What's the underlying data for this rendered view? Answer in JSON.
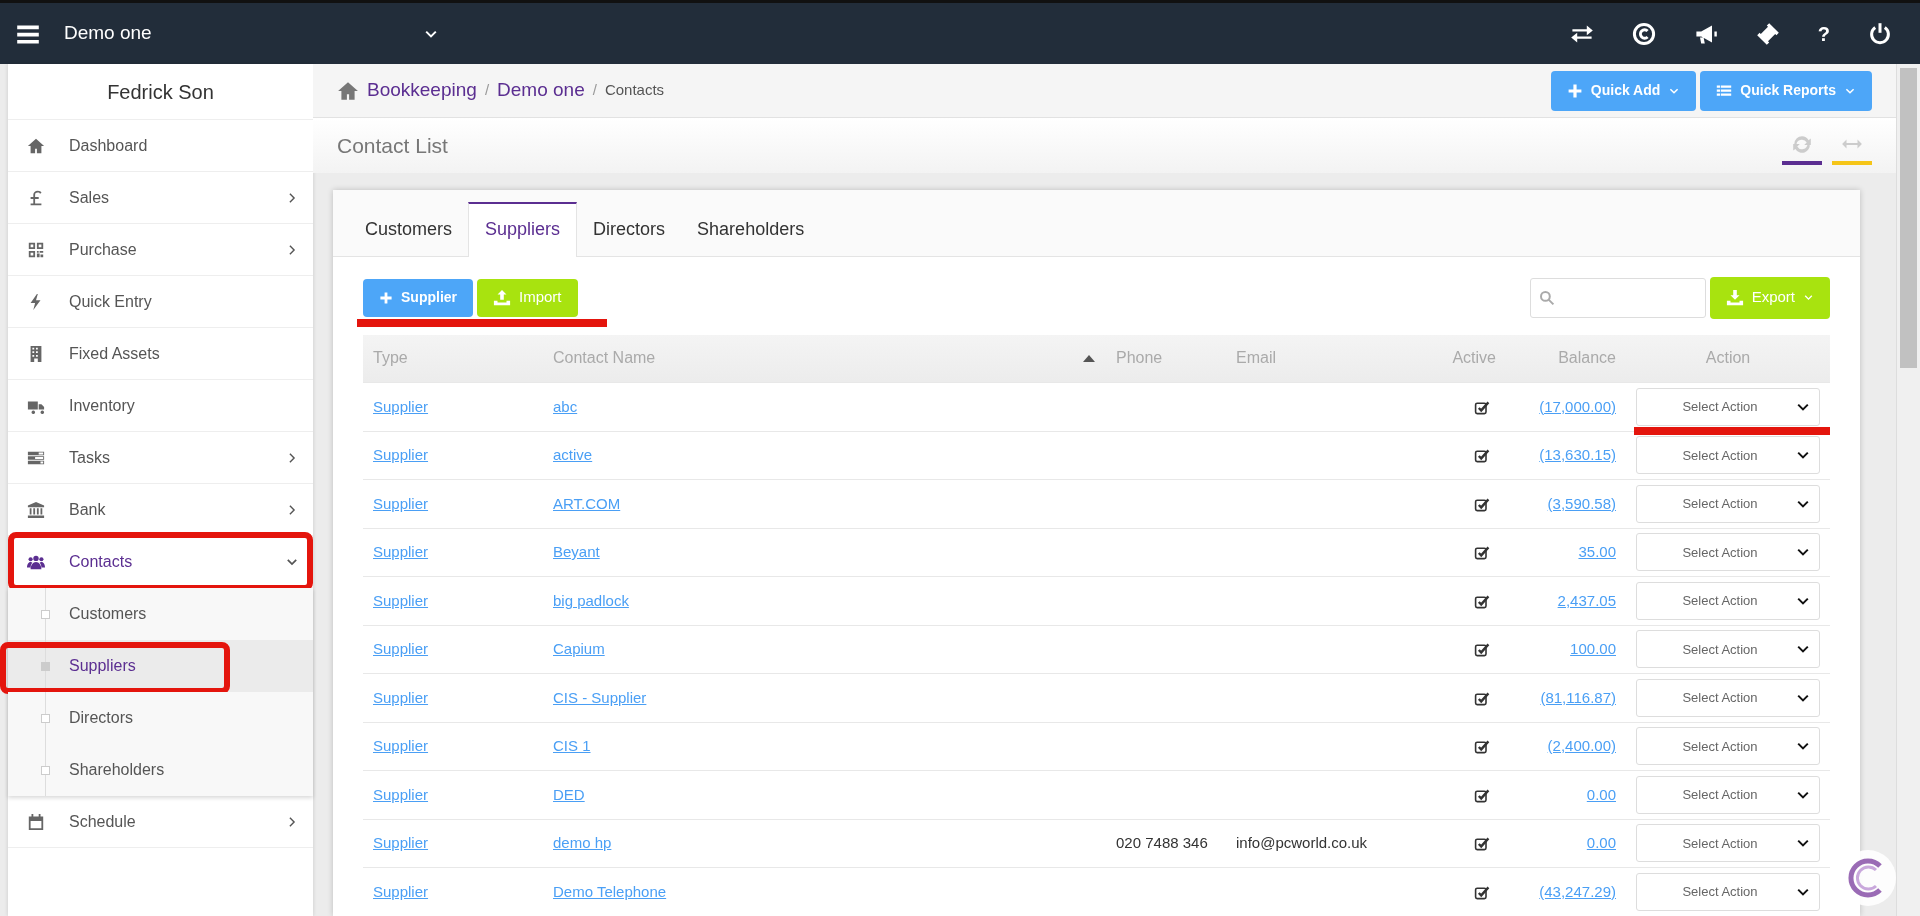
{
  "topbar": {
    "company": "Demo one",
    "help": "?"
  },
  "sidebar": {
    "user": "Fedrick Son",
    "items": [
      {
        "label": "Dashboard",
        "submenu": false,
        "expanded": false,
        "marked": false
      },
      {
        "label": "Sales",
        "submenu": true,
        "expanded": false,
        "marked": false
      },
      {
        "label": "Purchase",
        "submenu": true,
        "expanded": false,
        "marked": false
      },
      {
        "label": "Quick Entry",
        "submenu": false,
        "expanded": false,
        "marked": false
      },
      {
        "label": "Fixed Assets",
        "submenu": false,
        "expanded": false,
        "marked": false
      },
      {
        "label": "Inventory",
        "submenu": false,
        "expanded": false,
        "marked": false
      },
      {
        "label": "Tasks",
        "submenu": true,
        "expanded": false,
        "marked": false
      },
      {
        "label": "Bank",
        "submenu": true,
        "expanded": false,
        "marked": false
      },
      {
        "label": "Contacts",
        "submenu": true,
        "expanded": true,
        "marked": true,
        "children": [
          {
            "label": "Customers",
            "selected": false,
            "marked": false
          },
          {
            "label": "Suppliers",
            "selected": true,
            "marked": true
          },
          {
            "label": "Directors",
            "selected": false,
            "marked": false
          },
          {
            "label": "Shareholders",
            "selected": false,
            "marked": false
          }
        ]
      },
      {
        "label": "Schedule",
        "submenu": true,
        "expanded": false,
        "marked": false
      }
    ]
  },
  "breadcrumb": [
    {
      "label": "Bookkeeping",
      "separator": "/"
    },
    {
      "label": "Demo one",
      "separator": "/"
    },
    {
      "label": "Contacts"
    }
  ],
  "header_buttons": [
    "Quick Add",
    "Quick Reports"
  ],
  "page_title": "Contact List",
  "tabs": [
    {
      "label": "Customers",
      "selected": false
    },
    {
      "label": "Suppliers",
      "selected": true
    },
    {
      "label": "Directors",
      "selected": false
    },
    {
      "label": "Shareholders",
      "selected": false
    }
  ],
  "toolbar": {
    "add": "Supplier",
    "import": "Import",
    "export": "Export",
    "marked": true
  },
  "table": {
    "columns": [
      "Type",
      "Contact Name",
      "Phone",
      "Email",
      "Active",
      "Balance",
      "Action"
    ],
    "rows": [
      {
        "type": "Supplier",
        "name": "abc",
        "phone": "",
        "email": "",
        "active": true,
        "balance": "(17,000.00)",
        "action": "Select Action",
        "marked": true
      },
      {
        "type": "Supplier",
        "name": "active",
        "phone": "",
        "email": "",
        "active": true,
        "balance": "(13,630.15)",
        "action": "Select Action",
        "marked": false
      },
      {
        "type": "Supplier",
        "name": "ART.COM",
        "phone": "",
        "email": "",
        "active": true,
        "balance": "(3,590.58)",
        "action": "Select Action",
        "marked": false
      },
      {
        "type": "Supplier",
        "name": "Beyant",
        "phone": "",
        "email": "",
        "active": true,
        "balance": "35.00",
        "action": "Select Action",
        "marked": false
      },
      {
        "type": "Supplier",
        "name": "big padlock",
        "phone": "",
        "email": "",
        "active": true,
        "balance": "2,437.05",
        "action": "Select Action",
        "marked": false
      },
      {
        "type": "Supplier",
        "name": "Capium",
        "phone": "",
        "email": "",
        "active": true,
        "balance": "100.00",
        "action": "Select Action",
        "marked": false
      },
      {
        "type": "Supplier",
        "name": "CIS - Supplier",
        "phone": "",
        "email": "",
        "active": true,
        "balance": "(81,116.87)",
        "action": "Select Action",
        "marked": false
      },
      {
        "type": "Supplier",
        "name": "CIS 1",
        "phone": "",
        "email": "",
        "active": true,
        "balance": "(2,400.00)",
        "action": "Select Action",
        "marked": false
      },
      {
        "type": "Supplier",
        "name": "DED",
        "phone": "",
        "email": "",
        "active": true,
        "balance": "0.00",
        "action": "Select Action",
        "marked": false
      },
      {
        "type": "Supplier",
        "name": "demo hp",
        "phone": "020 7488 346",
        "email": "info@pcworld.co.uk",
        "active": true,
        "balance": "0.00",
        "action": "Select Action",
        "marked": false
      },
      {
        "type": "Supplier",
        "name": "Demo Telephone",
        "phone": "",
        "email": "",
        "active": true,
        "balance": "(43,247.29)",
        "action": "Select Action",
        "marked": false
      }
    ]
  }
}
